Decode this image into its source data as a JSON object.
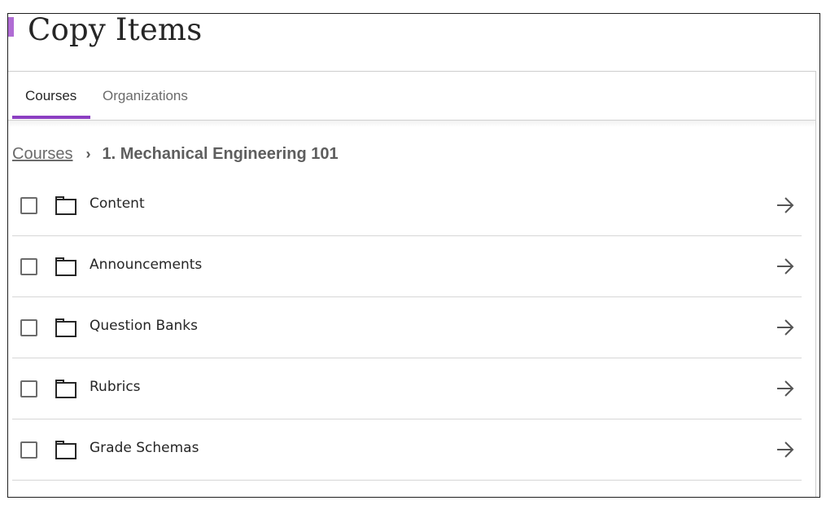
{
  "header": {
    "title": "Copy Items"
  },
  "tabs": [
    {
      "label": "Courses",
      "active": true
    },
    {
      "label": "Organizations",
      "active": false
    }
  ],
  "breadcrumb": {
    "link": "Courses",
    "current": "1. Mechanical Engineering 101"
  },
  "items": [
    {
      "label": "Content",
      "icon": "folder-icon",
      "checked": false
    },
    {
      "label": "Announcements",
      "icon": "folder-icon",
      "checked": false
    },
    {
      "label": "Question Banks",
      "icon": "folder-icon",
      "checked": false
    },
    {
      "label": "Rubrics",
      "icon": "folder-icon",
      "checked": false
    },
    {
      "label": "Grade Schemas",
      "icon": "folder-icon",
      "checked": false
    }
  ],
  "colors": {
    "accent": "#8c3fc2",
    "accent_bar": "#b06cd4",
    "text": "#262626",
    "muted": "#6b6b6b"
  }
}
